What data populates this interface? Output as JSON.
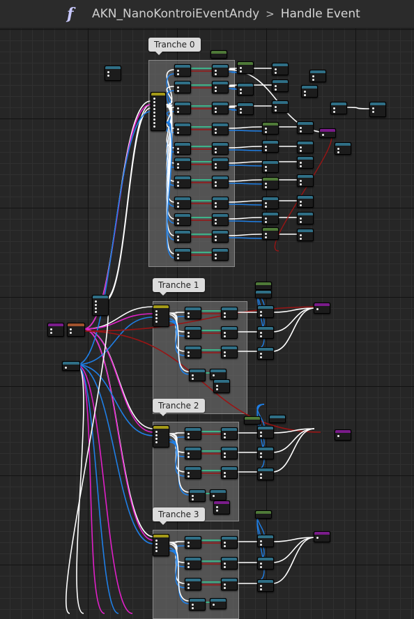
{
  "breadcrumb": {
    "function_icon": "function-icon",
    "graph_name": "AKN_NanoKontroiEventAndy",
    "separator": ">",
    "function_name": "Handle Event"
  },
  "comments": [
    {
      "label": "Tranche 0"
    },
    {
      "label": "Tranche 1"
    },
    {
      "label": "Tranche 2"
    },
    {
      "label": "Tranche 3"
    }
  ],
  "colors": {
    "canvas": "#262626",
    "exec_wire": "#ffffff",
    "object_wire": "#1f7fe6",
    "struct_wire": "#e020c8",
    "bool_wire": "#9a1414",
    "float_wire": "#38d39b",
    "node_header_teal": "#2f6f86",
    "node_header_green": "#4f7a38",
    "node_header_purple": "#7a1c8a",
    "node_header_yellow": "#a49a18"
  }
}
